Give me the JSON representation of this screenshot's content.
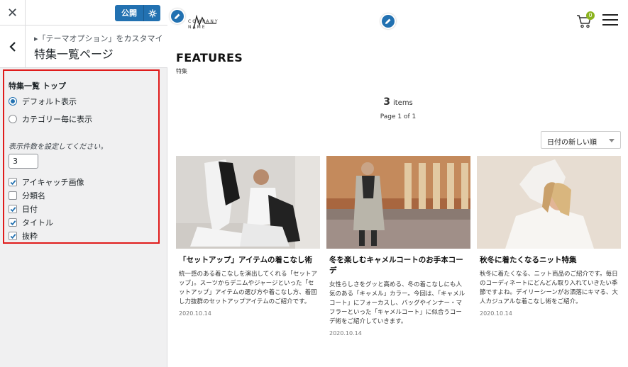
{
  "sidebar": {
    "publish_label": "公開",
    "breadcrumb": "▸「テーマオプション」をカスタマイ...",
    "section_name": "特集一覧ページ",
    "control_title": "特集一覧 トップ",
    "radios": [
      {
        "label": "デフォルト表示",
        "checked": true
      },
      {
        "label": "カテゴリー毎に表示",
        "checked": false
      }
    ],
    "count_label": "表示件数を設定してください。",
    "count_value": "3",
    "checkboxes": [
      {
        "label": "アイキャッチ画像",
        "checked": true
      },
      {
        "label": "分類名",
        "checked": false
      },
      {
        "label": "日付",
        "checked": true
      },
      {
        "label": "タイトル",
        "checked": true
      },
      {
        "label": "抜粋",
        "checked": true
      }
    ]
  },
  "preview": {
    "logo_text_line1": "COMPANY",
    "logo_text_line2": "NAME",
    "cart_count": "0",
    "page_title": "FEATURES",
    "page_subtitle": "特集",
    "items_count": "3",
    "items_label": "items",
    "pagination": "Page 1 of 1",
    "sort_value": "日付の新しい順",
    "cards": [
      {
        "title": "「セットアップ」アイテムの着こなし術",
        "excerpt": "統一感のある着こなしを演出してくれる「セットアップ」。スーツからデニムやジャージといった「セットアップ」アイテムの選び方や着こなし方、着回し力抜群のセットアップアイテムのご紹介です。",
        "date": "2020.10.14"
      },
      {
        "title": "冬を楽しむキャメルコートのお手本コーデ",
        "excerpt": "女性らしさをグッと高める、冬の着こなしにも人気のある「キャメル」カラー。今回は、「キャメルコート」にフォーカスし、バッグやインナー・マフラーといった「キャメルコート」に似合うコーデ術をご紹介していきます。",
        "date": "2020.10.14"
      },
      {
        "title": "秋冬に着たくなるニット特集",
        "excerpt": "秋冬に着たくなる、ニット商品のご紹介です。毎日のコーディネートにどんどん取り入れていきたい季節ですよね。デイリーシーンがお洒落にキマる、大人カジュアルな着こなし術をご紹介。",
        "date": "2020.10.14"
      }
    ]
  },
  "colors": {
    "accent": "#2271b1",
    "highlight_border": "#e01b1b",
    "badge": "#8bb31d"
  }
}
